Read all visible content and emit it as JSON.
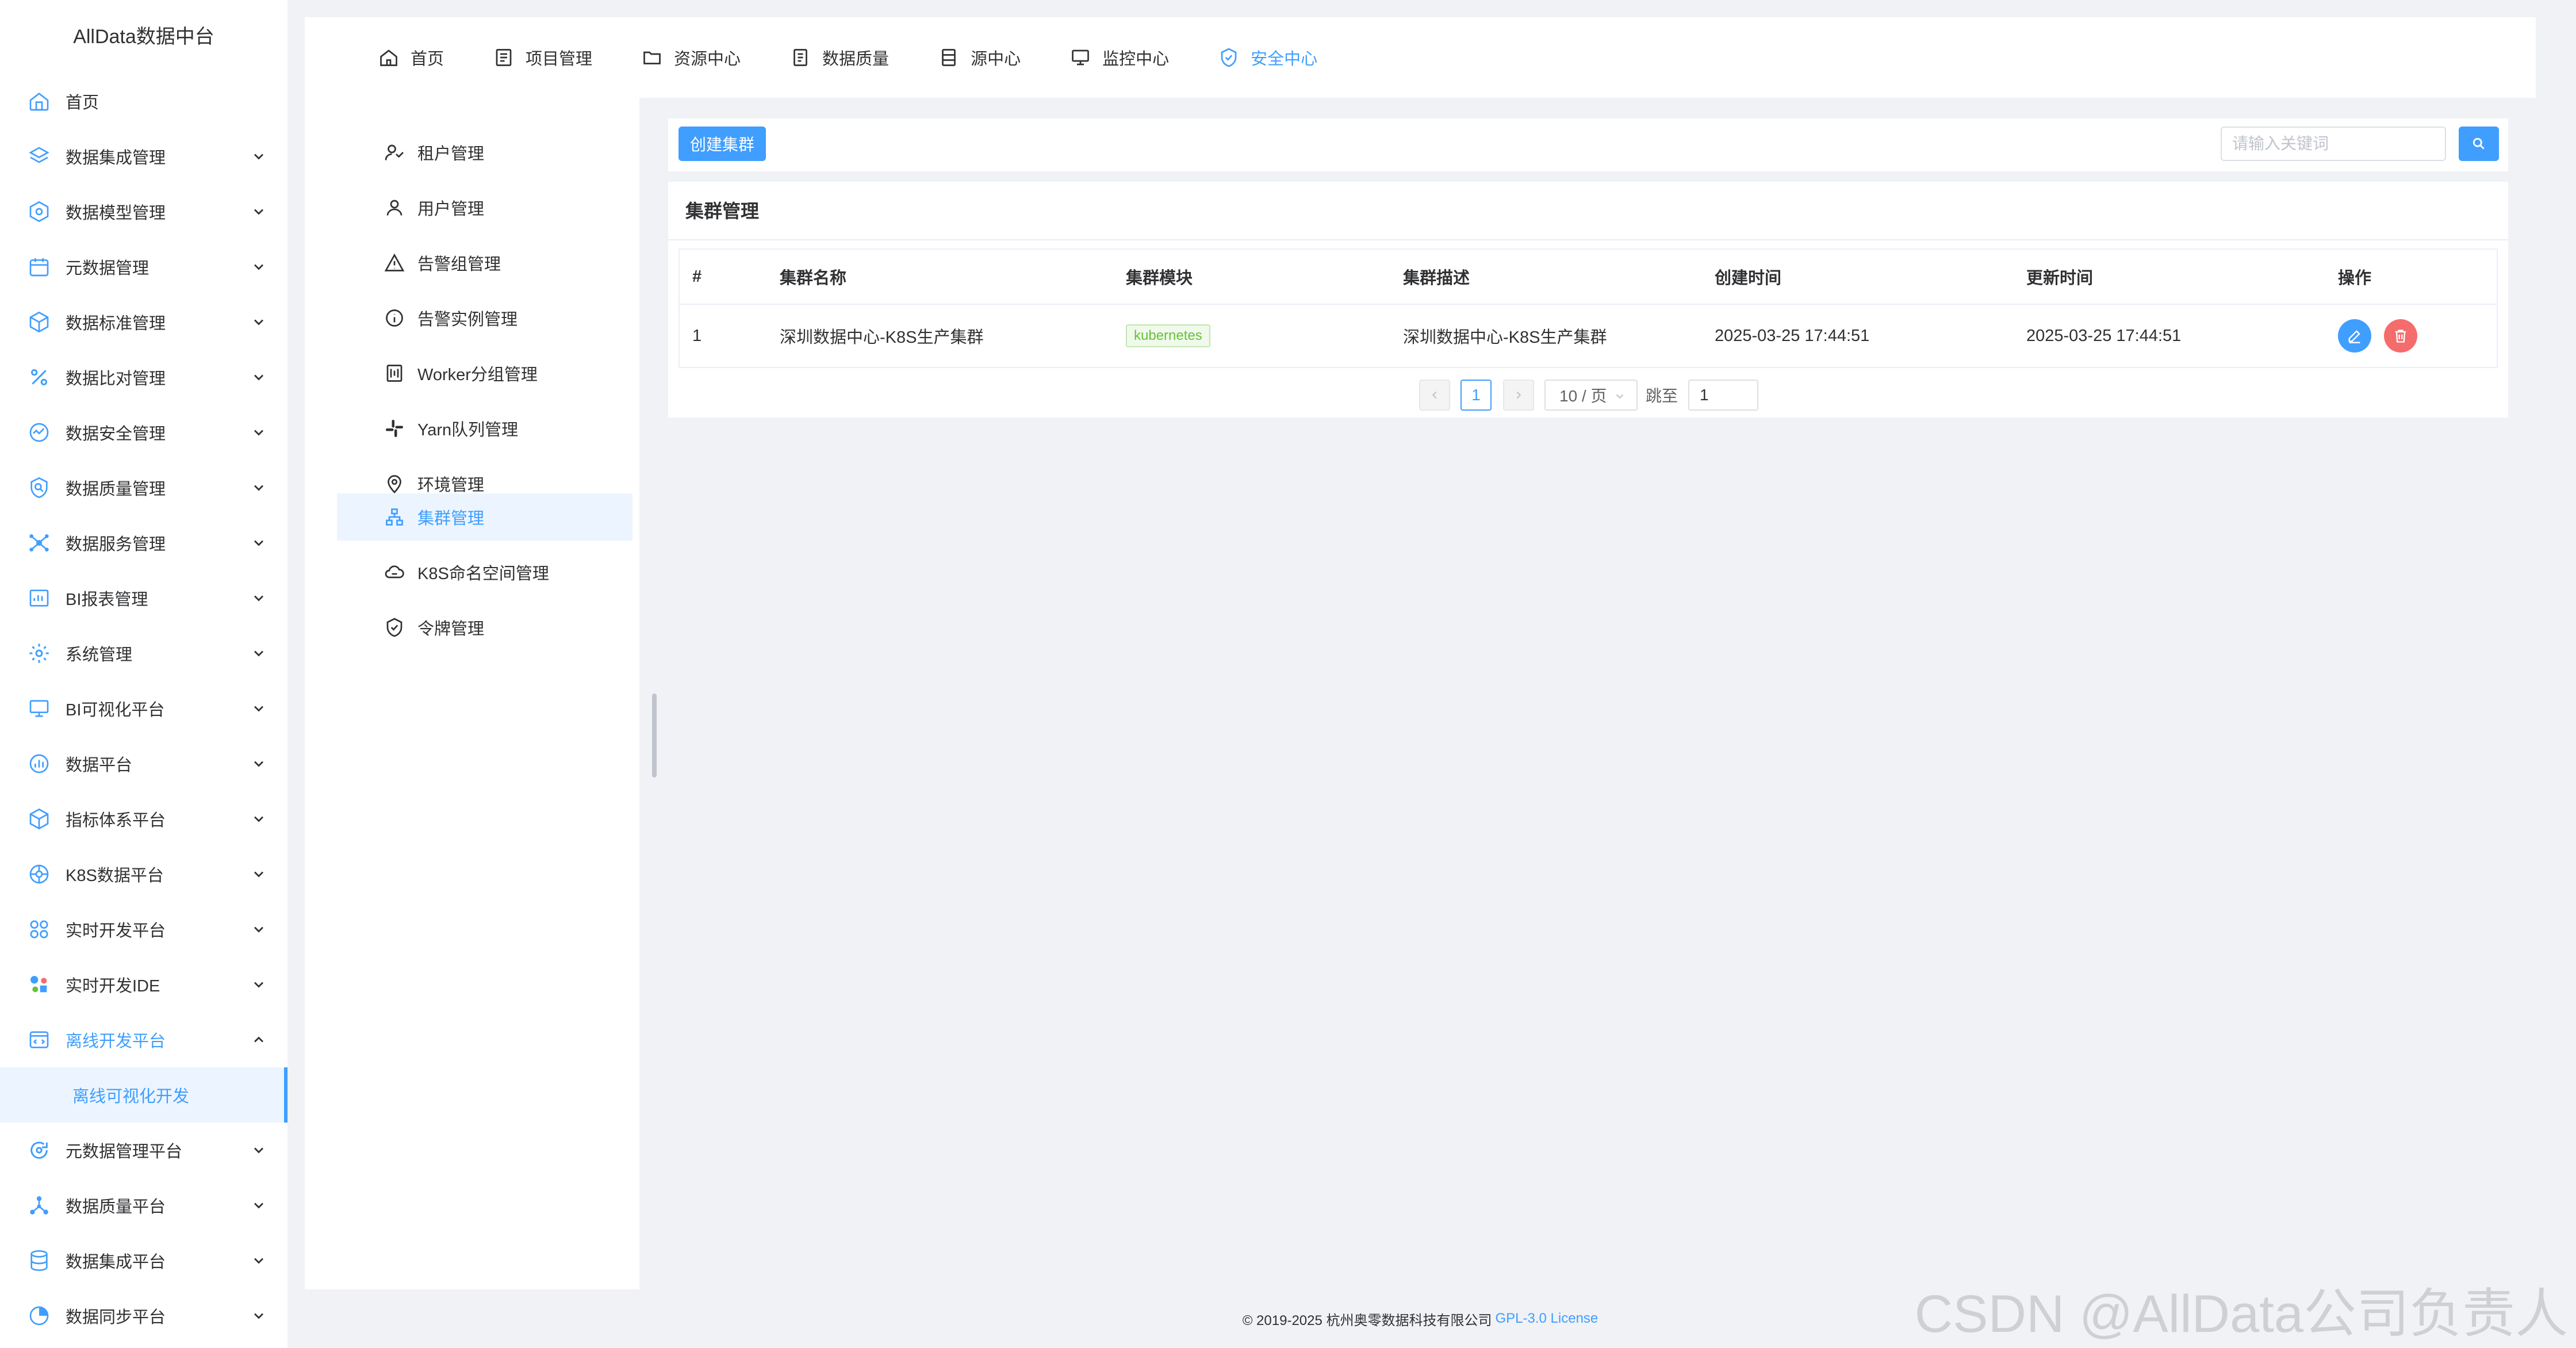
{
  "app": {
    "brand": "AllData数据中台"
  },
  "sidebar": {
    "items": [
      {
        "label": "首页",
        "icon": "home-icon",
        "expandable": false
      },
      {
        "label": "数据集成管理",
        "icon": "layers-icon",
        "expandable": true
      },
      {
        "label": "数据模型管理",
        "icon": "hexagon-gear-icon",
        "expandable": true
      },
      {
        "label": "元数据管理",
        "icon": "calendar-icon",
        "expandable": true
      },
      {
        "label": "数据标准管理",
        "icon": "cube-icon",
        "expandable": true
      },
      {
        "label": "数据比对管理",
        "icon": "percent-icon",
        "expandable": true
      },
      {
        "label": "数据安全管理",
        "icon": "shield-chart-icon",
        "expandable": true
      },
      {
        "label": "数据质量管理",
        "icon": "search-shield-icon",
        "expandable": true
      },
      {
        "label": "数据服务管理",
        "icon": "network-icon",
        "expandable": true
      },
      {
        "label": "BI报表管理",
        "icon": "report-icon",
        "expandable": true
      },
      {
        "label": "系统管理",
        "icon": "gear-icon",
        "expandable": true
      },
      {
        "label": "BI可视化平台",
        "icon": "monitor-icon",
        "expandable": true
      },
      {
        "label": "数据平台",
        "icon": "bar-chart-icon",
        "expandable": true
      },
      {
        "label": "指标体系平台",
        "icon": "box-icon",
        "expandable": true
      },
      {
        "label": "K8S数据平台",
        "icon": "k8s-icon",
        "expandable": true
      },
      {
        "label": "实时开发平台",
        "icon": "grid-circles-icon",
        "expandable": true
      },
      {
        "label": "实时开发IDE",
        "icon": "ide-icon",
        "expandable": true
      },
      {
        "label": "离线开发平台",
        "icon": "code-window-icon",
        "expandable": true,
        "open": true
      }
    ],
    "active_sub": "离线可视化开发",
    "items_after": [
      {
        "label": "元数据管理平台",
        "icon": "refresh-icon",
        "expandable": true
      },
      {
        "label": "数据质量平台",
        "icon": "share-icon",
        "expandable": true
      },
      {
        "label": "数据集成平台",
        "icon": "database-icon",
        "expandable": true
      },
      {
        "label": "数据同步平台",
        "icon": "pie-icon",
        "expandable": true
      }
    ]
  },
  "tabs": [
    {
      "label": "首页",
      "icon": "home-icon"
    },
    {
      "label": "项目管理",
      "icon": "list-icon"
    },
    {
      "label": "资源中心",
      "icon": "folder-icon"
    },
    {
      "label": "数据质量",
      "icon": "document-check-icon"
    },
    {
      "label": "源中心",
      "icon": "server-icon"
    },
    {
      "label": "监控中心",
      "icon": "monitor-icon"
    },
    {
      "label": "安全中心",
      "icon": "shield-check-icon",
      "active": true
    }
  ],
  "submenu": {
    "items": [
      {
        "label": "租户管理",
        "icon": "tenant-icon"
      },
      {
        "label": "用户管理",
        "icon": "user-icon"
      },
      {
        "label": "告警组管理",
        "icon": "warning-icon"
      },
      {
        "label": "告警实例管理",
        "icon": "info-icon"
      },
      {
        "label": "Worker分组管理",
        "icon": "worker-icon"
      },
      {
        "label": "Yarn队列管理",
        "icon": "slack-icon"
      },
      {
        "label": "环境管理",
        "icon": "location-icon"
      },
      {
        "label": "集群管理",
        "icon": "cluster-icon",
        "active": true
      },
      {
        "label": "K8S命名空间管理",
        "icon": "cloud-icon"
      },
      {
        "label": "令牌管理",
        "icon": "shield-icon"
      }
    ]
  },
  "toolbar": {
    "create_label": "创建集群",
    "search_placeholder": "请输入关键词"
  },
  "card": {
    "title": "集群管理"
  },
  "table": {
    "columns": [
      "#",
      "集群名称",
      "集群模块",
      "集群描述",
      "创建时间",
      "更新时间",
      "操作"
    ],
    "rows": [
      {
        "index": "1",
        "name": "深圳数据中心-K8S生产集群",
        "module": "kubernetes",
        "description": "深圳数据中心-K8S生产集群",
        "created": "2025-03-25 17:44:51",
        "updated": "2025-03-25 17:44:51"
      }
    ]
  },
  "pagination": {
    "current": "1",
    "page_size": "10 / 页",
    "jump_label": "跳至",
    "jump_value": "1"
  },
  "footer": {
    "copyright": "© 2019-2025 杭州奥零数据科技有限公司",
    "license": "GPL-3.0 License"
  },
  "watermark": "CSDN @AllData公司负责人",
  "colors": {
    "accent": "#409eff",
    "danger": "#f56c6c",
    "tag_green": "#67c23a"
  }
}
